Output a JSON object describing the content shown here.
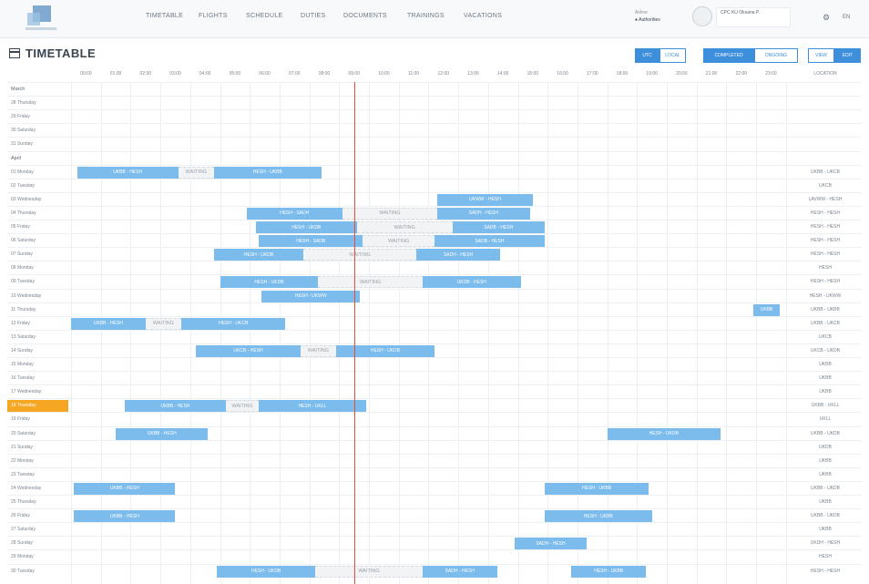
{
  "nav": {
    "items": [
      "TIMETABLE",
      "FLIGHTS",
      "SCHEDULE",
      "DUTIES",
      "DOCUMENTS",
      "TRAININGS",
      "VACATIONS"
    ]
  },
  "header": {
    "airline_label": "Airline",
    "airline_value": "● Authorities",
    "user_name": "CPC KU Oksana P.",
    "lang": "EN",
    "bell_icon": "bell-icon"
  },
  "page": {
    "title": "TIMETABLE",
    "tz_toggle": [
      "UTC",
      "LOCAL"
    ],
    "view_toggle": [
      "COMPLETED",
      "ONGOING"
    ],
    "mode_toggle": [
      "VIEW",
      "EDIT"
    ]
  },
  "grid": {
    "hours": [
      "00:00",
      "01:00",
      "02:00",
      "03:00",
      "04:00",
      "05:00",
      "06:00",
      "07:00",
      "08:00",
      "09:00",
      "10:00",
      "11:00",
      "12:00",
      "13:00",
      "14:00",
      "15:00",
      "16:00",
      "17:00",
      "18:00",
      "19:00",
      "20:00",
      "21:00",
      "22:00",
      "23:00"
    ],
    "location_header": "LOCATION",
    "now_hour": 9.5,
    "rows": [
      {
        "type": "month",
        "label": "March"
      },
      {
        "type": "day",
        "label": "28 Thursday",
        "loc": "",
        "items": []
      },
      {
        "type": "day",
        "label": "29 Friday",
        "loc": "",
        "items": []
      },
      {
        "type": "day",
        "label": "30 Saturday",
        "loc": "",
        "items": []
      },
      {
        "type": "day",
        "label": "31 Sunday",
        "loc": "",
        "items": []
      },
      {
        "type": "month",
        "label": "April"
      },
      {
        "type": "day",
        "label": "01 Monday",
        "loc": "UKBB - UKCB",
        "items": [
          {
            "k": "bar",
            "s": 0.2,
            "e": 3.6,
            "t": "UKBB - HESH"
          },
          {
            "k": "wait",
            "s": 3.6,
            "e": 4.8,
            "t": "WAITING"
          },
          {
            "k": "bar",
            "s": 4.8,
            "e": 8.4,
            "t": "HESH - UKBB"
          }
        ]
      },
      {
        "type": "day",
        "label": "02 Tuesday",
        "loc": "UKCB",
        "items": []
      },
      {
        "type": "day",
        "label": "03 Wednesday",
        "loc": "LAVWW - HESH",
        "items": [
          {
            "k": "bar",
            "s": 12.3,
            "e": 15.5,
            "t": "UKWW - HESH"
          }
        ]
      },
      {
        "type": "day",
        "label": "04 Thursday",
        "loc": "HESH - HESH",
        "items": [
          {
            "k": "bar",
            "s": 5.9,
            "e": 9.1,
            "t": "HESH - SADH"
          },
          {
            "k": "wait",
            "s": 9.1,
            "e": 12.3,
            "t": "WAITING"
          },
          {
            "k": "bar",
            "s": 12.3,
            "e": 15.4,
            "t": "SADH - HESH"
          }
        ]
      },
      {
        "type": "day",
        "label": "05 Friday",
        "loc": "HESH - HESH",
        "items": [
          {
            "k": "bar",
            "s": 6.2,
            "e": 9.6,
            "t": "HESH - UKDB"
          },
          {
            "k": "wait",
            "s": 9.6,
            "e": 12.8,
            "t": "WAITING"
          },
          {
            "k": "bar",
            "s": 12.8,
            "e": 15.9,
            "t": "SADB - HESH"
          }
        ]
      },
      {
        "type": "day",
        "label": "06 Saturday",
        "loc": "HESH - HESH",
        "items": [
          {
            "k": "bar",
            "s": 6.3,
            "e": 9.8,
            "t": "HESH - SADB"
          },
          {
            "k": "wait",
            "s": 9.8,
            "e": 12.2,
            "t": "WAITING"
          },
          {
            "k": "bar",
            "s": 12.2,
            "e": 15.9,
            "t": "SADB - HESH"
          }
        ]
      },
      {
        "type": "day",
        "label": "07 Sunday",
        "loc": "HESH - HESH",
        "items": [
          {
            "k": "bar",
            "s": 4.8,
            "e": 7.8,
            "t": "HESH - UKDB"
          },
          {
            "k": "wait",
            "s": 7.8,
            "e": 11.6,
            "t": "WAITING"
          },
          {
            "k": "bar",
            "s": 11.6,
            "e": 14.4,
            "t": "SADH - HESH"
          }
        ]
      },
      {
        "type": "day",
        "label": "08 Monday",
        "loc": "HESH",
        "items": []
      },
      {
        "type": "day",
        "label": "09 Tuesday",
        "loc": "HESH - HESH",
        "items": [
          {
            "k": "bar",
            "s": 5.0,
            "e": 8.3,
            "t": "HESH - UKDB"
          },
          {
            "k": "wait",
            "s": 8.3,
            "e": 11.8,
            "t": "WAITING"
          },
          {
            "k": "bar",
            "s": 11.8,
            "e": 15.1,
            "t": "UKDB - HESH"
          }
        ]
      },
      {
        "type": "day",
        "label": "10 Wednesday",
        "loc": "HESH - UKWW",
        "items": [
          {
            "k": "bar",
            "s": 6.4,
            "e": 9.7,
            "t": "HESH - UKWW"
          }
        ]
      },
      {
        "type": "day",
        "label": "11 Thursday",
        "loc": "UKBB - UKBB",
        "items": [
          {
            "k": "bar",
            "s": 22.9,
            "e": 23.8,
            "t": "UKBB"
          }
        ]
      },
      {
        "type": "day",
        "label": "12 Friday",
        "loc": "UKBB - UKCB",
        "items": [
          {
            "k": "bar",
            "s": 0.0,
            "e": 2.5,
            "t": "UKBB - HESH"
          },
          {
            "k": "wait",
            "s": 2.5,
            "e": 3.7,
            "t": "WAITING"
          },
          {
            "k": "bar",
            "s": 3.7,
            "e": 7.2,
            "t": "HESH - UKCB"
          }
        ]
      },
      {
        "type": "day",
        "label": "13 Saturday",
        "loc": "UKCB",
        "items": []
      },
      {
        "type": "day",
        "label": "14 Sunday",
        "loc": "UKCB - UKDB",
        "items": [
          {
            "k": "bar",
            "s": 4.2,
            "e": 7.7,
            "t": "UKCB - HESH"
          },
          {
            "k": "wait",
            "s": 7.7,
            "e": 8.9,
            "t": "WAITING"
          },
          {
            "k": "bar",
            "s": 8.9,
            "e": 12.2,
            "t": "HESH - UKDB"
          }
        ]
      },
      {
        "type": "day",
        "label": "15 Monday",
        "loc": "UKBB",
        "items": []
      },
      {
        "type": "day",
        "label": "16 Tuesday",
        "loc": "UKBB",
        "items": []
      },
      {
        "type": "day",
        "label": "17 Wednesday",
        "loc": "UKBB",
        "items": []
      },
      {
        "type": "day",
        "label": "18 Thursday",
        "loc": "UKBB - UKLL",
        "today": true,
        "items": [
          {
            "k": "bar",
            "s": 1.8,
            "e": 5.2,
            "t": "UKBB - HESH"
          },
          {
            "k": "wait",
            "s": 5.2,
            "e": 6.3,
            "t": "WAITING"
          },
          {
            "k": "bar",
            "s": 6.3,
            "e": 9.9,
            "t": "HESH - UKLL"
          }
        ]
      },
      {
        "type": "day",
        "label": "19 Friday",
        "loc": "UKLL",
        "items": []
      },
      {
        "type": "day",
        "label": "20 Saturday",
        "loc": "UKBB - UKDB",
        "items": [
          {
            "k": "bar",
            "s": 1.5,
            "e": 4.6,
            "t": "UKBB - HESH"
          },
          {
            "k": "bar",
            "s": 18.0,
            "e": 21.8,
            "t": "HESH - UKDB"
          }
        ]
      },
      {
        "type": "day",
        "label": "21 Sunday",
        "loc": "UKDB",
        "items": []
      },
      {
        "type": "day",
        "label": "22 Monday",
        "loc": "UKBB",
        "items": []
      },
      {
        "type": "day",
        "label": "23 Tuesday",
        "loc": "UKBB",
        "items": []
      },
      {
        "type": "day",
        "label": "24 Wednesday",
        "loc": "UKBB - UKDB",
        "items": [
          {
            "k": "bar",
            "s": 0.1,
            "e": 3.5,
            "t": "UKBB - HESH"
          },
          {
            "k": "bar",
            "s": 15.9,
            "e": 19.4,
            "t": "HESH - UKBB"
          }
        ]
      },
      {
        "type": "day",
        "label": "25 Thursday",
        "loc": "UKBB",
        "items": []
      },
      {
        "type": "day",
        "label": "26 Friday",
        "loc": "UKBB - UKDB",
        "items": [
          {
            "k": "bar",
            "s": 0.1,
            "e": 3.5,
            "t": "UKBB - HESH"
          },
          {
            "k": "bar",
            "s": 15.9,
            "e": 19.5,
            "t": "HESH - UKBB"
          }
        ]
      },
      {
        "type": "day",
        "label": "27 Saturday",
        "loc": "UKBB",
        "items": []
      },
      {
        "type": "day",
        "label": "28 Sunday",
        "loc": "UKDH - HESH",
        "items": [
          {
            "k": "bar",
            "s": 14.9,
            "e": 17.3,
            "t": "SADH - HESH"
          }
        ]
      },
      {
        "type": "day",
        "label": "29 Monday",
        "loc": "HESH",
        "items": []
      },
      {
        "type": "day",
        "label": "30 Tuesday",
        "loc": "HESH - HESH",
        "items": [
          {
            "k": "bar",
            "s": 4.9,
            "e": 8.2,
            "t": "HESH - UKDB"
          },
          {
            "k": "wait",
            "s": 8.2,
            "e": 11.8,
            "t": "WAITING"
          },
          {
            "k": "bar",
            "s": 11.8,
            "e": 14.3,
            "t": "SADH - HESH"
          },
          {
            "k": "bar",
            "s": 16.8,
            "e": 19.3,
            "t": "HESH - UKBB"
          }
        ]
      }
    ]
  }
}
